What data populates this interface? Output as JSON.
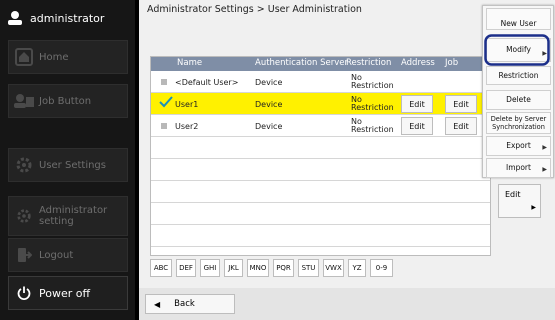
{
  "sidebar": {
    "user": {
      "label": "administrator"
    },
    "items": [
      {
        "label": "Home",
        "icon": "home-icon"
      },
      {
        "label": "Job Button",
        "icon": "job-icon"
      },
      {
        "label": "User Settings",
        "icon": "gear-icon"
      },
      {
        "label": "Administrator setting",
        "icon": "gear-icon"
      },
      {
        "label": "Logout",
        "icon": "logout-icon"
      }
    ],
    "power": {
      "label": "Power off"
    }
  },
  "breadcrumb": "Administrator Settings > User Administration",
  "table": {
    "headers": [
      "Name",
      "Authentication Server",
      "Restriction",
      "Address",
      "Job"
    ],
    "rows": [
      {
        "name": "<Default User>",
        "auth": "Device",
        "restriction": "No Restriction",
        "address": "",
        "job": "",
        "selected": false
      },
      {
        "name": "User1",
        "auth": "Device",
        "restriction": "No Restriction",
        "address": "Edit",
        "job": "Edit",
        "selected": true
      },
      {
        "name": "User2",
        "auth": "Device",
        "restriction": "No Restriction",
        "address": "Edit",
        "job": "Edit",
        "selected": false
      }
    ]
  },
  "index_tabs": [
    "ABC",
    "DEF",
    "GHI",
    "JKL",
    "MNO",
    "PQR",
    "STU",
    "VWX",
    "YZ",
    "0-9"
  ],
  "footer": {
    "back": "Back"
  },
  "menu": {
    "new_user": "New User",
    "modify": "Modify",
    "restriction": "Restriction",
    "delete": "Delete",
    "delete_sync": "Delete by Server Synchronization",
    "export": "Export",
    "import": "Import"
  },
  "side_edit": "Edit",
  "colors": {
    "selected_row": "#fff100",
    "header": "#7f8ea6",
    "focus_ring": "#1c2f8a"
  }
}
